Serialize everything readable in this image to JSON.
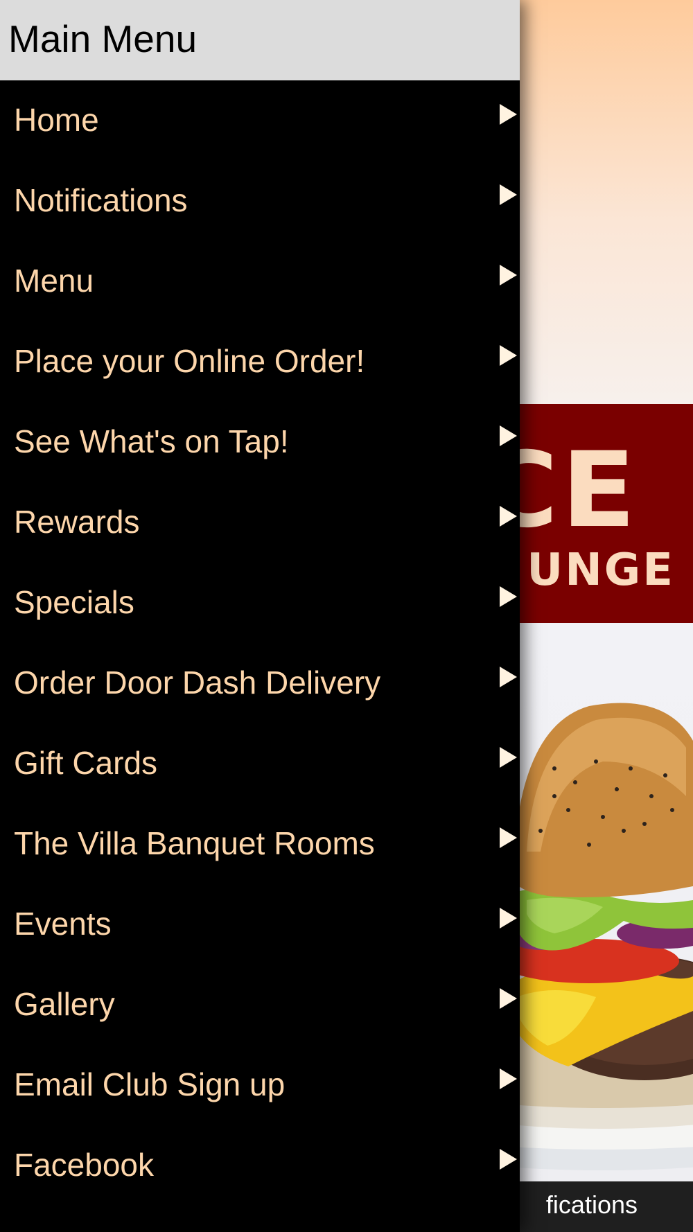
{
  "drawer": {
    "title": "Main Menu",
    "items": [
      {
        "label": "Home",
        "name": "home"
      },
      {
        "label": "Notifications",
        "name": "notifications"
      },
      {
        "label": "Menu",
        "name": "menu"
      },
      {
        "label": "Place your Online Order!",
        "name": "online-order"
      },
      {
        "label": "See What's on Tap!",
        "name": "on-tap"
      },
      {
        "label": "Rewards",
        "name": "rewards"
      },
      {
        "label": "Specials",
        "name": "specials"
      },
      {
        "label": "Order Door Dash Delivery",
        "name": "door-dash"
      },
      {
        "label": "Gift Cards",
        "name": "gift-cards"
      },
      {
        "label": "The Villa Banquet Rooms",
        "name": "banquet-rooms"
      },
      {
        "label": "Events",
        "name": "events"
      },
      {
        "label": "Gallery",
        "name": "gallery"
      },
      {
        "label": "Email Club Sign up",
        "name": "email-club"
      },
      {
        "label": "Facebook",
        "name": "facebook"
      }
    ],
    "item_icon": "chevron-right-icon"
  },
  "background": {
    "banner_line1": "CE",
    "banner_line2": "UNGE",
    "tab_label": "fications",
    "photo": "burger-photo"
  },
  "colors": {
    "menu_text": "#fdd6ab",
    "drawer_bg": "#000000",
    "header_bg": "#dcdcdc",
    "banner_bg": "#7a0000"
  }
}
